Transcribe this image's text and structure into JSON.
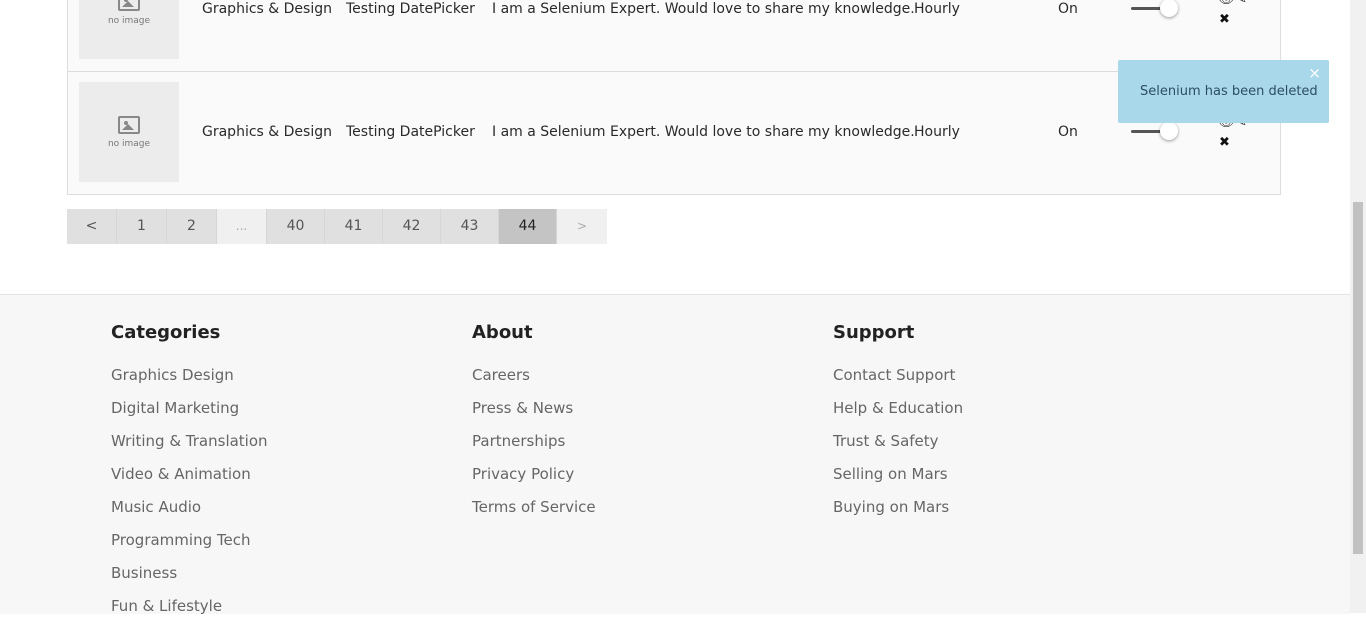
{
  "rows": [
    {
      "image_caption": "no image",
      "category": "Graphics & Design",
      "title": "Testing DatePicker",
      "description": "I am a Selenium Expert. Would love to share my knowledge.",
      "type": "Hourly",
      "status": "On"
    },
    {
      "image_caption": "no image",
      "category": "Graphics & Design",
      "title": "Testing DatePicker",
      "description": "I am a Selenium Expert. Would love to share my knowledge.",
      "type": "Hourly",
      "status": "On"
    }
  ],
  "pagination": {
    "prev": "<",
    "pages": [
      "1",
      "2",
      "...",
      "40",
      "41",
      "42",
      "43",
      "44"
    ],
    "next": ">",
    "current": "44"
  },
  "toast": {
    "message": "Selenium has been deleted",
    "close": "×"
  },
  "footer": {
    "categories": {
      "heading": "Categories",
      "links": [
        "Graphics Design",
        "Digital Marketing",
        "Writing & Translation",
        "Video & Animation",
        "Music Audio",
        "Programming Tech",
        "Business",
        "Fun & Lifestyle"
      ]
    },
    "about": {
      "heading": "About",
      "links": [
        "Careers",
        "Press & News",
        "Partnerships",
        "Privacy Policy",
        "Terms of Service"
      ]
    },
    "support": {
      "heading": "Support",
      "links": [
        "Contact Support",
        "Help & Education",
        "Trust & Safety",
        "Selling on Mars",
        "Buying on Mars"
      ]
    }
  },
  "icons": {
    "view": "eye-icon",
    "edit": "pencil-icon",
    "delete": "close-icon",
    "image": "image-placeholder-icon"
  }
}
